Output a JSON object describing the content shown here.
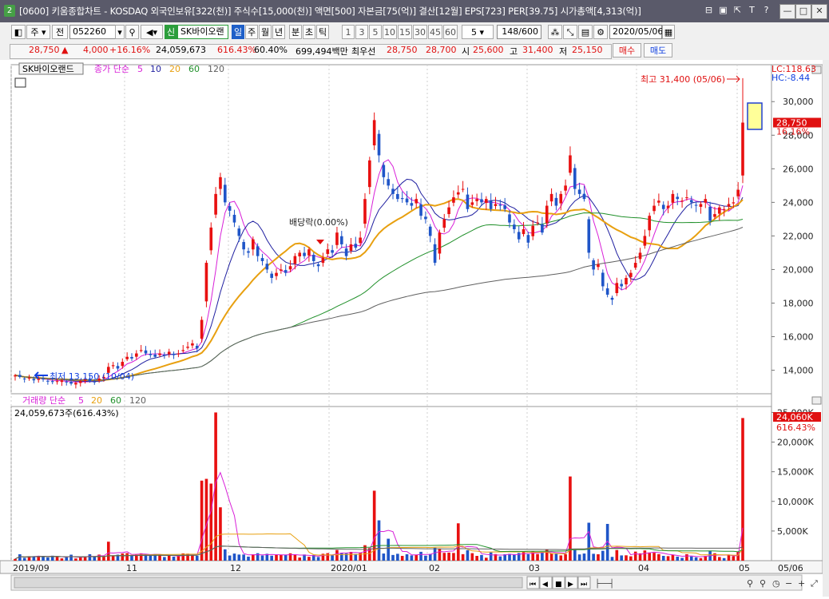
{
  "window": {
    "number": "2",
    "title": "[0600] 키움종합차트 - KOSDAQ 외국인보유[322(천)] 주식수[15,000(천)] 액면[500] 자본금[75(억)] 결산[12월] EPS[723] PER[39.75] 시가총액[4,313(억)]"
  },
  "toolbar": {
    "period": "주",
    "prev": "전",
    "code": "052260",
    "badge": "신",
    "name": "SK바이오랜",
    "periods": [
      "일",
      "주",
      "월",
      "년",
      "분",
      "초",
      "틱"
    ],
    "active_period": "일",
    "intervals": [
      "1",
      "3",
      "5",
      "10",
      "15",
      "30",
      "45",
      "60"
    ],
    "interval_value": "5",
    "count": "148/600",
    "date": "2020/05/06"
  },
  "quote": {
    "price": "28,750",
    "change": "4,000",
    "change_pct": "+16.16%",
    "volume": "24,059,673",
    "volume_ratio": "616.43%",
    "turnover": "60.40%",
    "amount": "699,494백만",
    "best_label": "최우선",
    "best_ask": "28,750",
    "best_bid": "28,700",
    "open_label": "시",
    "open": "25,600",
    "high_label": "고",
    "high": "31,400",
    "low_label": "저",
    "low": "25,150",
    "buy_label": "매수",
    "sell_label": "매도"
  },
  "price_panel": {
    "legend_name": "SK바이오랜드",
    "legend_ma_prefix": "종가 단순",
    "ma_periods": [
      "5",
      "10",
      "20",
      "60",
      "120"
    ],
    "lc": "LC:118.63",
    "hc": "HC:-8.44",
    "high_annotation": "최고 31,400 (05/06)",
    "low_annotation": "최저 13,150 (10/04)",
    "dividend_annotation": "배당락(0.00%)",
    "current_price_tag": "28,750",
    "current_pct_tag": "16.16%"
  },
  "volume_panel": {
    "legend_prefix": "거래량 단순",
    "ma_periods": [
      "5",
      "20",
      "60",
      "120"
    ],
    "info": "24,059,673주(616.43%)",
    "current_tag": "24,060K",
    "current_pct": "616.43%"
  },
  "x_axis": {
    "labels": [
      "2019/09",
      "11",
      "12",
      "2020/01",
      "02",
      "03",
      "04",
      "05"
    ],
    "end_label": "05/06"
  },
  "colors": {
    "up": "#e81010",
    "down": "#1f55c8",
    "ma5": "#d81fd8",
    "ma10": "#1f1fa0",
    "ma20": "#e8a010",
    "ma60": "#20902a",
    "ma120": "#606060"
  },
  "chart_data": {
    "type": "candlestick",
    "y_ticks": [
      14000,
      16000,
      18000,
      20000,
      22000,
      24000,
      26000,
      28000,
      30000
    ],
    "ylim": [
      12600,
      32200
    ],
    "volume_ticks": [
      "5,000K",
      "10,000K",
      "15,000K",
      "20,000K",
      "25,000K"
    ],
    "volume_ylim_k": [
      0,
      26000
    ],
    "daily_closes": [
      13700,
      13600,
      13500,
      13550,
      13400,
      13500,
      13450,
      13350,
      13300,
      13350,
      13400,
      13300,
      13200,
      13250,
      13350,
      13450,
      13350,
      13300,
      13500,
      13600,
      14200,
      14300,
      14100,
      14500,
      14800,
      14700,
      15000,
      15200,
      15000,
      14900,
      14800,
      15000,
      14900,
      15100,
      14900,
      15000,
      15200,
      15400,
      15600,
      15300,
      17000,
      20400,
      22500,
      24500,
      25500,
      24000,
      23500,
      22800,
      22000,
      21200,
      21000,
      21800,
      20800,
      20500,
      20000,
      19500,
      19800,
      20000,
      19800,
      20200,
      20800,
      21000,
      20800,
      21200,
      20500,
      20200,
      20700,
      21200,
      21000,
      22200,
      21500,
      20800,
      21500,
      21300,
      21900,
      24200,
      26500,
      28900,
      26800,
      25500,
      25000,
      24500,
      24200,
      24200,
      24000,
      23800,
      24200,
      23200,
      23000,
      22000,
      20400,
      22200,
      23000,
      23700,
      24300,
      24600,
      24800,
      23600,
      24000,
      24200,
      24000,
      24200,
      23600,
      23900,
      23800,
      23600,
      22800,
      22400,
      21800,
      22400,
      21600,
      22600,
      22800,
      22200,
      23800,
      24500,
      23800,
      24500,
      25000,
      26800,
      24800,
      24500,
      24200,
      21000,
      20000,
      20300,
      19000,
      18500,
      18200,
      19200,
      19000,
      19500,
      19800,
      20400,
      21000,
      22000,
      23200,
      23800,
      24100,
      23600,
      23800,
      24500,
      24200,
      24100,
      24300,
      24000,
      23800,
      23900,
      24200,
      22900,
      23300,
      23700,
      23600,
      23900,
      24000,
      24750,
      28750
    ]
  }
}
